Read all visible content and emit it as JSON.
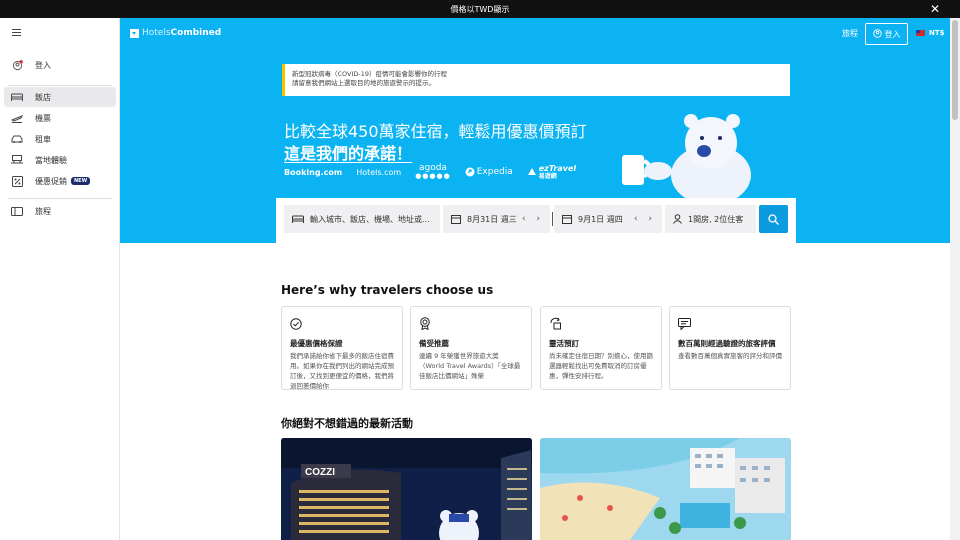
{
  "topbar": {
    "text": "價格以TWD顯示"
  },
  "sidebar": {
    "login": "登入",
    "items": [
      {
        "label": "飯店",
        "icon": "bed-icon",
        "active": true
      },
      {
        "label": "機票",
        "icon": "plane-icon"
      },
      {
        "label": "租車",
        "icon": "car-icon"
      },
      {
        "label": "當地體驗",
        "icon": "activities-icon"
      },
      {
        "label": "優惠促銷",
        "icon": "deals-icon",
        "badge": "NEW"
      }
    ],
    "trips": "旅程"
  },
  "header": {
    "logo_hotels": "Hotels",
    "logo_combined": "Combined",
    "trips": "旅程",
    "login": "登入",
    "currency": "NT$"
  },
  "notice": {
    "line1": "新型冠狀病毒（COVID-19）疫情可能會影響你的行程",
    "line2": "請留意我們網站上選取目的地的旅遊警示的提示。"
  },
  "hero": {
    "headline": "比較全球450萬家住宿，輕鬆用優惠價預訂",
    "subhead": "這是我們的承諾！",
    "partners": {
      "booking": "Booking.com",
      "hotels": "Hotels.com",
      "agoda": "agoda",
      "expedia": "Expedia",
      "eztravel_top": "ezTravel",
      "eztravel_bottom": "易遊網"
    }
  },
  "search": {
    "destination_placeholder": "輸入城市、飯店、機場、地址或...",
    "checkin": "8月31日 週三",
    "checkout": "9月1日 週四",
    "guests": "1間房, 2位住客"
  },
  "why": {
    "title": "Here’s why travelers choose us",
    "cards": [
      {
        "title": "最優惠價格保證",
        "desc": "我們承諾給你省下最多的飯店住宿費用。如果你在我們列出的網站完成預訂後，又找到更便宜的價格，我們將退回差價給你",
        "icon": "check-circle-icon"
      },
      {
        "title": "備受推薦",
        "desc": "連續 9 年榮獲世界旅遊大獎（World Travel Awards）「全球最佳飯店比價網站」殊榮",
        "icon": "award-icon"
      },
      {
        "title": "靈活預訂",
        "desc": "尚未確定住宿日期？別擔心，使用篩選器輕鬆找出可免費取消的訂房優惠，彈性安排行程。",
        "icon": "calendar-flex-icon"
      },
      {
        "title": "數百萬則經過驗證的旅客評價",
        "desc": "查看數百萬個真實旅客的評分和評價",
        "icon": "review-icon"
      }
    ]
  },
  "promos": {
    "title": "你絕對不想錯過的最新活動",
    "hotel_sign": "COZZI"
  },
  "colors": {
    "hero": "#0bb3f2",
    "search_button": "#0a9cdf",
    "notice_accent": "#f5c400"
  }
}
